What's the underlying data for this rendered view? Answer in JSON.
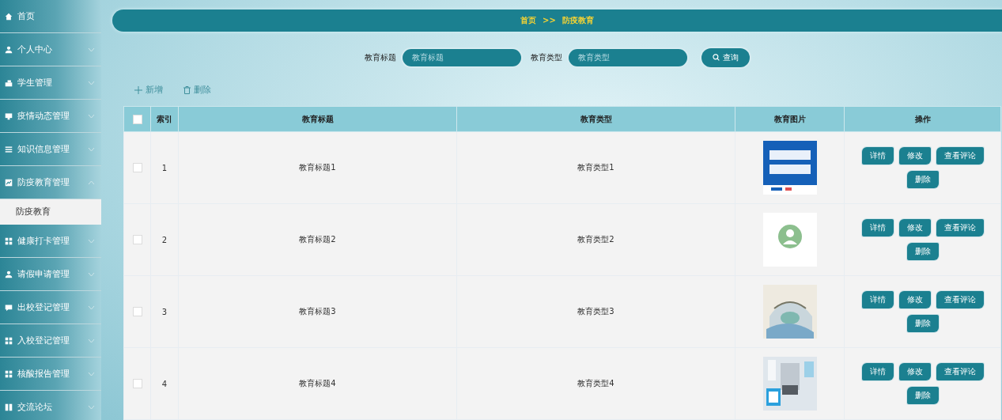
{
  "sidebar": {
    "items": [
      {
        "label": "首页",
        "kind": "link"
      },
      {
        "label": "个人中心",
        "kind": "group",
        "expanded": false
      },
      {
        "label": "学生管理",
        "kind": "group",
        "expanded": false
      },
      {
        "label": "疫情动态管理",
        "kind": "group",
        "expanded": false
      },
      {
        "label": "知识信息管理",
        "kind": "group",
        "expanded": false
      },
      {
        "label": "防疫教育管理",
        "kind": "group",
        "expanded": true,
        "children": [
          {
            "label": "防疫教育",
            "selected": true
          }
        ]
      },
      {
        "label": "健康打卡管理",
        "kind": "group",
        "expanded": false
      },
      {
        "label": "请假申请管理",
        "kind": "group",
        "expanded": false
      },
      {
        "label": "出校登记管理",
        "kind": "group",
        "expanded": false
      },
      {
        "label": "入校登记管理",
        "kind": "group",
        "expanded": false
      },
      {
        "label": "核酸报告管理",
        "kind": "group",
        "expanded": false
      },
      {
        "label": "交流论坛",
        "kind": "group",
        "expanded": false
      }
    ]
  },
  "breadcrumb": {
    "home": "首页",
    "separator": ">>",
    "current": "防疫教育"
  },
  "search": {
    "fields": [
      {
        "label": "教育标题",
        "placeholder": "教育标题"
      },
      {
        "label": "教育类型",
        "placeholder": "教育类型"
      }
    ],
    "button": "查询"
  },
  "toolbar": {
    "add": "新增",
    "delete": "删除"
  },
  "table": {
    "header_checked": false,
    "columns": [
      "索引",
      "教育标题",
      "教育类型",
      "教育图片",
      "操作"
    ],
    "rows": [
      {
        "checked": false,
        "index": "1",
        "title": "教育标题1",
        "type": "教育类型1",
        "actions": [
          "详情",
          "修改",
          "查看评论",
          "删除"
        ]
      },
      {
        "checked": false,
        "index": "2",
        "title": "教育标题2",
        "type": "教育类型2",
        "actions": [
          "详情",
          "修改",
          "查看评论",
          "删除"
        ]
      },
      {
        "checked": false,
        "index": "3",
        "title": "教育标题3",
        "type": "教育类型3",
        "actions": [
          "详情",
          "修改",
          "查看评论",
          "删除"
        ]
      },
      {
        "checked": false,
        "index": "4",
        "title": "教育标题4",
        "type": "教育类型4",
        "actions": [
          "详情",
          "修改",
          "查看评论",
          "删除"
        ]
      }
    ]
  }
}
